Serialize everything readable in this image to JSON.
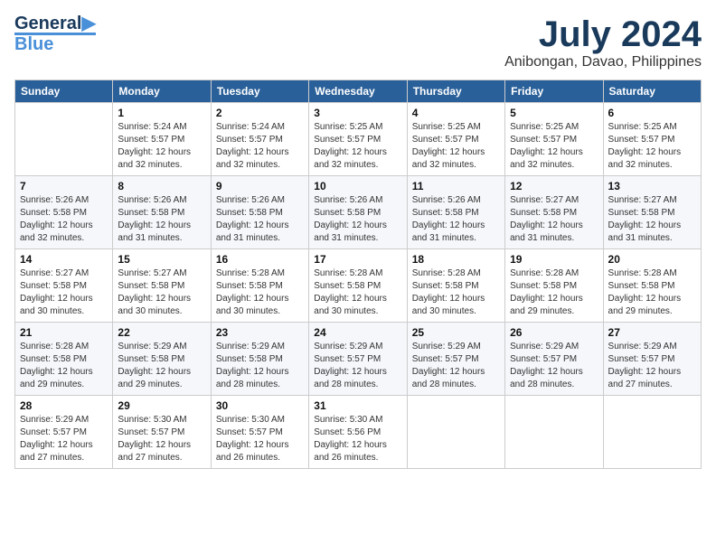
{
  "logo": {
    "line1": "General",
    "line2": "Blue"
  },
  "header": {
    "month": "July 2024",
    "location": "Anibongan, Davao, Philippines"
  },
  "columns": [
    "Sunday",
    "Monday",
    "Tuesday",
    "Wednesday",
    "Thursday",
    "Friday",
    "Saturday"
  ],
  "weeks": [
    [
      {
        "day": "",
        "info": ""
      },
      {
        "day": "1",
        "info": "Sunrise: 5:24 AM\nSunset: 5:57 PM\nDaylight: 12 hours\nand 32 minutes."
      },
      {
        "day": "2",
        "info": "Sunrise: 5:24 AM\nSunset: 5:57 PM\nDaylight: 12 hours\nand 32 minutes."
      },
      {
        "day": "3",
        "info": "Sunrise: 5:25 AM\nSunset: 5:57 PM\nDaylight: 12 hours\nand 32 minutes."
      },
      {
        "day": "4",
        "info": "Sunrise: 5:25 AM\nSunset: 5:57 PM\nDaylight: 12 hours\nand 32 minutes."
      },
      {
        "day": "5",
        "info": "Sunrise: 5:25 AM\nSunset: 5:57 PM\nDaylight: 12 hours\nand 32 minutes."
      },
      {
        "day": "6",
        "info": "Sunrise: 5:25 AM\nSunset: 5:57 PM\nDaylight: 12 hours\nand 32 minutes."
      }
    ],
    [
      {
        "day": "7",
        "info": "Sunrise: 5:26 AM\nSunset: 5:58 PM\nDaylight: 12 hours\nand 32 minutes."
      },
      {
        "day": "8",
        "info": "Sunrise: 5:26 AM\nSunset: 5:58 PM\nDaylight: 12 hours\nand 31 minutes."
      },
      {
        "day": "9",
        "info": "Sunrise: 5:26 AM\nSunset: 5:58 PM\nDaylight: 12 hours\nand 31 minutes."
      },
      {
        "day": "10",
        "info": "Sunrise: 5:26 AM\nSunset: 5:58 PM\nDaylight: 12 hours\nand 31 minutes."
      },
      {
        "day": "11",
        "info": "Sunrise: 5:26 AM\nSunset: 5:58 PM\nDaylight: 12 hours\nand 31 minutes."
      },
      {
        "day": "12",
        "info": "Sunrise: 5:27 AM\nSunset: 5:58 PM\nDaylight: 12 hours\nand 31 minutes."
      },
      {
        "day": "13",
        "info": "Sunrise: 5:27 AM\nSunset: 5:58 PM\nDaylight: 12 hours\nand 31 minutes."
      }
    ],
    [
      {
        "day": "14",
        "info": "Sunrise: 5:27 AM\nSunset: 5:58 PM\nDaylight: 12 hours\nand 30 minutes."
      },
      {
        "day": "15",
        "info": "Sunrise: 5:27 AM\nSunset: 5:58 PM\nDaylight: 12 hours\nand 30 minutes."
      },
      {
        "day": "16",
        "info": "Sunrise: 5:28 AM\nSunset: 5:58 PM\nDaylight: 12 hours\nand 30 minutes."
      },
      {
        "day": "17",
        "info": "Sunrise: 5:28 AM\nSunset: 5:58 PM\nDaylight: 12 hours\nand 30 minutes."
      },
      {
        "day": "18",
        "info": "Sunrise: 5:28 AM\nSunset: 5:58 PM\nDaylight: 12 hours\nand 30 minutes."
      },
      {
        "day": "19",
        "info": "Sunrise: 5:28 AM\nSunset: 5:58 PM\nDaylight: 12 hours\nand 29 minutes."
      },
      {
        "day": "20",
        "info": "Sunrise: 5:28 AM\nSunset: 5:58 PM\nDaylight: 12 hours\nand 29 minutes."
      }
    ],
    [
      {
        "day": "21",
        "info": "Sunrise: 5:28 AM\nSunset: 5:58 PM\nDaylight: 12 hours\nand 29 minutes."
      },
      {
        "day": "22",
        "info": "Sunrise: 5:29 AM\nSunset: 5:58 PM\nDaylight: 12 hours\nand 29 minutes."
      },
      {
        "day": "23",
        "info": "Sunrise: 5:29 AM\nSunset: 5:58 PM\nDaylight: 12 hours\nand 28 minutes."
      },
      {
        "day": "24",
        "info": "Sunrise: 5:29 AM\nSunset: 5:57 PM\nDaylight: 12 hours\nand 28 minutes."
      },
      {
        "day": "25",
        "info": "Sunrise: 5:29 AM\nSunset: 5:57 PM\nDaylight: 12 hours\nand 28 minutes."
      },
      {
        "day": "26",
        "info": "Sunrise: 5:29 AM\nSunset: 5:57 PM\nDaylight: 12 hours\nand 28 minutes."
      },
      {
        "day": "27",
        "info": "Sunrise: 5:29 AM\nSunset: 5:57 PM\nDaylight: 12 hours\nand 27 minutes."
      }
    ],
    [
      {
        "day": "28",
        "info": "Sunrise: 5:29 AM\nSunset: 5:57 PM\nDaylight: 12 hours\nand 27 minutes."
      },
      {
        "day": "29",
        "info": "Sunrise: 5:30 AM\nSunset: 5:57 PM\nDaylight: 12 hours\nand 27 minutes."
      },
      {
        "day": "30",
        "info": "Sunrise: 5:30 AM\nSunset: 5:57 PM\nDaylight: 12 hours\nand 26 minutes."
      },
      {
        "day": "31",
        "info": "Sunrise: 5:30 AM\nSunset: 5:56 PM\nDaylight: 12 hours\nand 26 minutes."
      },
      {
        "day": "",
        "info": ""
      },
      {
        "day": "",
        "info": ""
      },
      {
        "day": "",
        "info": ""
      }
    ]
  ]
}
